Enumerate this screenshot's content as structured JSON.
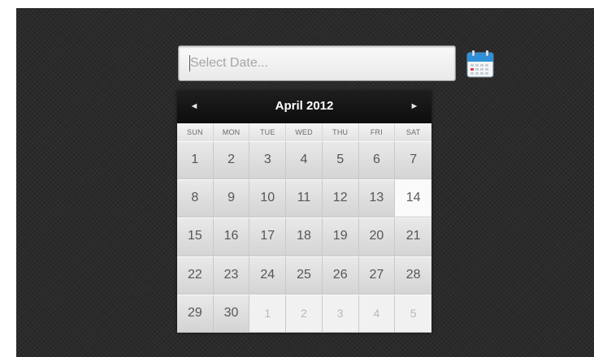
{
  "search": {
    "placeholder": "Select Date..."
  },
  "calendar": {
    "month_label": "April 2012",
    "prev_label": "◄",
    "next_label": "►",
    "weekdays": [
      "SUN",
      "MON",
      "TUE",
      "WED",
      "THU",
      "FRI",
      "SAT"
    ],
    "selected_day": "14",
    "days": [
      {
        "label": "1",
        "other": false
      },
      {
        "label": "2",
        "other": false
      },
      {
        "label": "3",
        "other": false
      },
      {
        "label": "4",
        "other": false
      },
      {
        "label": "5",
        "other": false
      },
      {
        "label": "6",
        "other": false
      },
      {
        "label": "7",
        "other": false
      },
      {
        "label": "8",
        "other": false
      },
      {
        "label": "9",
        "other": false
      },
      {
        "label": "10",
        "other": false
      },
      {
        "label": "11",
        "other": false
      },
      {
        "label": "12",
        "other": false
      },
      {
        "label": "13",
        "other": false
      },
      {
        "label": "14",
        "other": false
      },
      {
        "label": "15",
        "other": false
      },
      {
        "label": "16",
        "other": false
      },
      {
        "label": "17",
        "other": false
      },
      {
        "label": "18",
        "other": false
      },
      {
        "label": "19",
        "other": false
      },
      {
        "label": "20",
        "other": false
      },
      {
        "label": "21",
        "other": false
      },
      {
        "label": "22",
        "other": false
      },
      {
        "label": "23",
        "other": false
      },
      {
        "label": "24",
        "other": false
      },
      {
        "label": "25",
        "other": false
      },
      {
        "label": "26",
        "other": false
      },
      {
        "label": "27",
        "other": false
      },
      {
        "label": "28",
        "other": false
      },
      {
        "label": "29",
        "other": false
      },
      {
        "label": "30",
        "other": false
      },
      {
        "label": "1",
        "other": true
      },
      {
        "label": "2",
        "other": true
      },
      {
        "label": "3",
        "other": true
      },
      {
        "label": "4",
        "other": true
      },
      {
        "label": "5",
        "other": true
      }
    ]
  },
  "icons": {
    "calendar_button": "calendar-icon"
  },
  "colors": {
    "background": "#2b2b2b",
    "header": "#111111",
    "day_cell": "#dedede",
    "today_cell": "#fafafa"
  }
}
